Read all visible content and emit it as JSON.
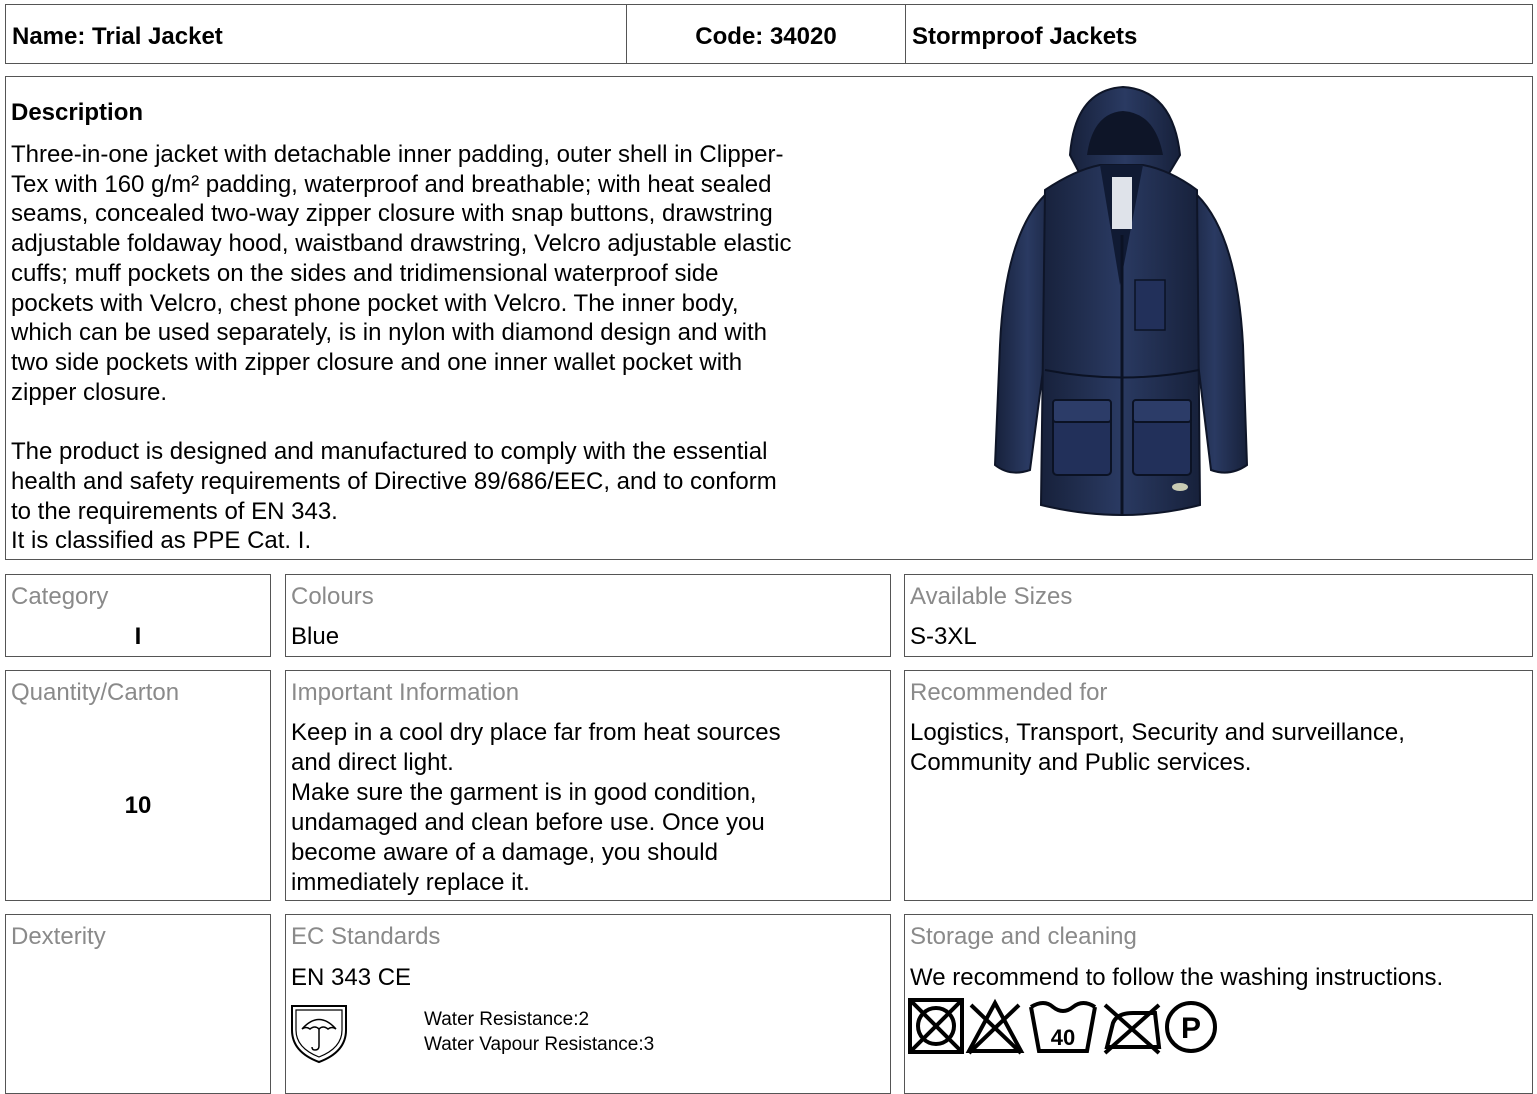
{
  "header": {
    "name": "Name: Trial Jacket",
    "code": "Code: 34020",
    "category": "Stormproof Jackets"
  },
  "description": {
    "title": "Description",
    "lines_p1": [
      "Three-in-one jacket with detachable inner padding, outer shell in Clipper-",
      "Tex with 160 g/m²  padding, waterproof and breathable; with heat sealed",
      "seams, concealed two-way zipper closure with snap buttons, drawstring",
      "adjustable foldaway hood, waistband drawstring, Velcro adjustable elastic",
      "cuffs; muff pockets on the sides and tridimensional waterproof side",
      "pockets with Velcro, chest phone pocket with Velcro. The inner body,",
      "which can be used separately, is in nylon with diamond design and with",
      "two side pockets with zipper closure and one inner wallet pocket with",
      "zipper closure."
    ],
    "lines_p2": [
      "The product is designed and manufactured to comply with the essential",
      "health and safety requirements of Directive 89/686/EEC,  and to conform",
      "to the requirements of EN 343.",
      "It is classified as PPE Cat. I."
    ]
  },
  "category": {
    "label": "Category",
    "value": "I"
  },
  "colours": {
    "label": "Colours",
    "value": "Blue"
  },
  "sizes": {
    "label": "Available Sizes",
    "value": "S-3XL"
  },
  "quantity": {
    "label": "Quantity/Carton",
    "value": "10"
  },
  "important": {
    "label": "Important Information",
    "lines": [
      "Keep in a cool dry place far from heat sources",
      "and direct light.",
      "Make sure the garment is in good condition,",
      "undamaged and clean before use. Once you",
      "become aware of a damage, you should",
      "immediately replace it."
    ]
  },
  "recommended": {
    "label": "Recommended for",
    "lines": [
      "Logistics, Transport, Security and surveillance,",
      "Community and Public services."
    ]
  },
  "dexterity": {
    "label": "Dexterity"
  },
  "standards": {
    "label": "EC Standards",
    "value": "EN 343 CE",
    "water_resistance": "Water Resistance:2",
    "vapour_resistance": "Water Vapour Resistance:3",
    "pictogram": "umbrella-shield-icon"
  },
  "storage": {
    "label": "Storage and cleaning",
    "value": "We recommend to follow the washing instructions.",
    "care_icons": [
      "no-tumble-dry-icon",
      "no-bleach-icon",
      "wash-40-icon",
      "no-iron-icon",
      "dry-clean-p-icon"
    ],
    "wash_temp": "40",
    "dry_clean_letter": "P"
  },
  "colors": {
    "jacket": "#1f2c4d",
    "border": "#555555",
    "label_gray": "#8a8a8a"
  }
}
